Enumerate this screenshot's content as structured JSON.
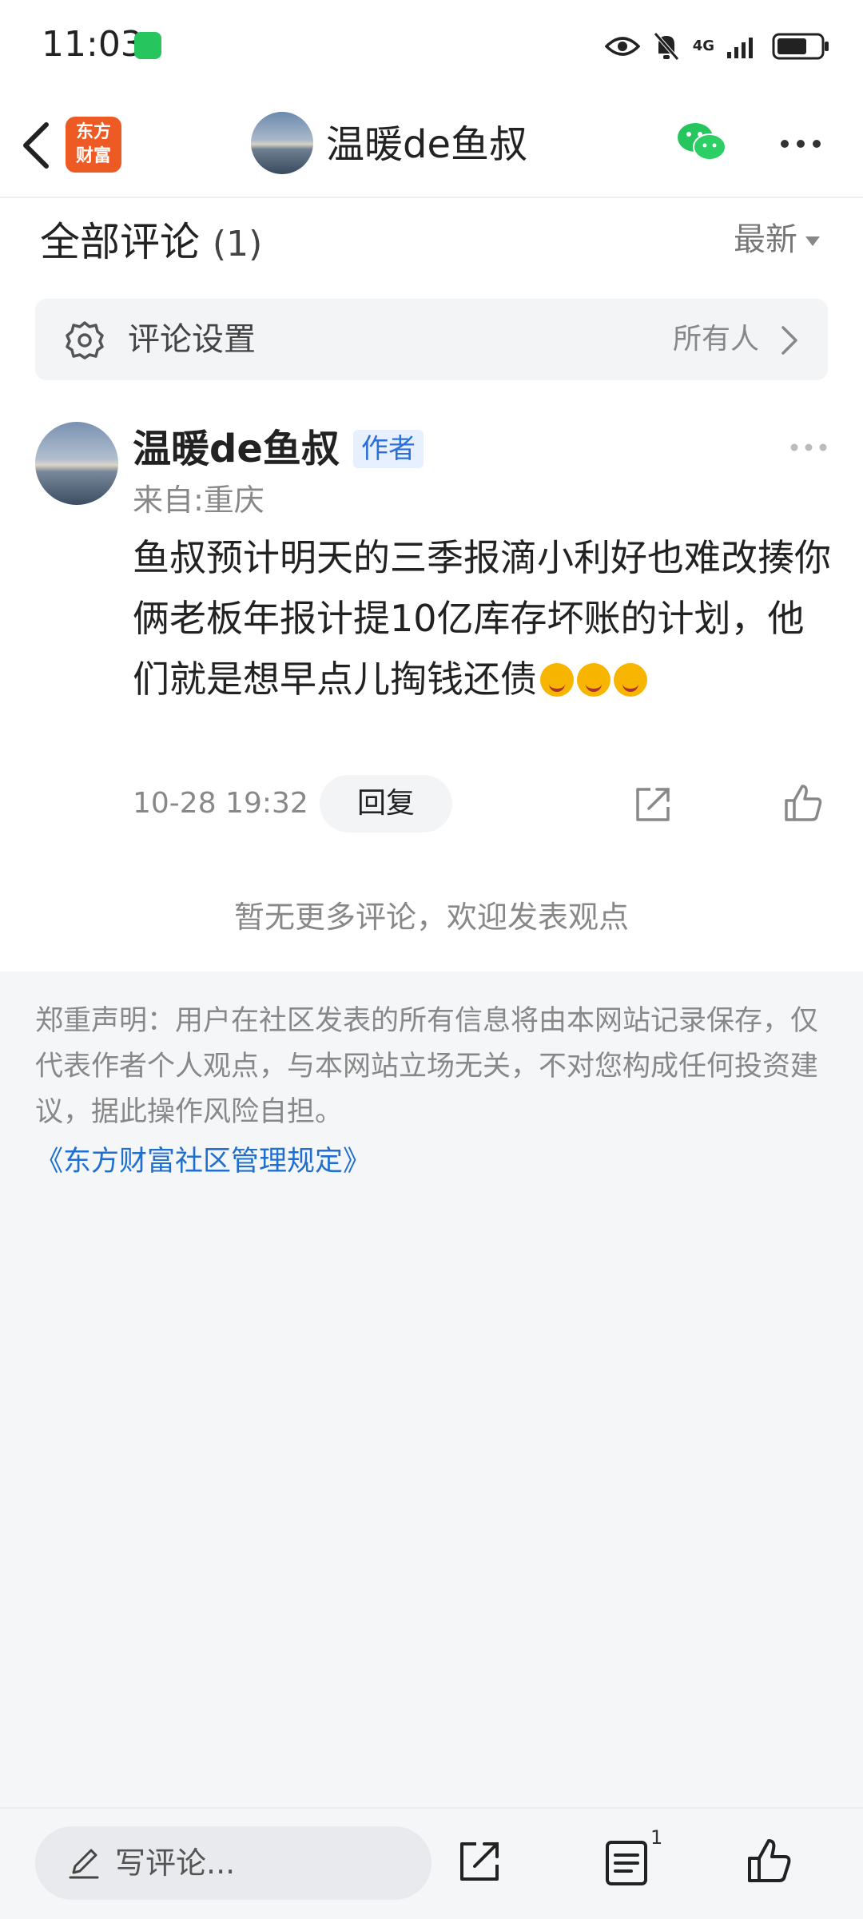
{
  "status_bar": {
    "time": "11:03",
    "network": "4G"
  },
  "nav": {
    "logo_line1": "东方",
    "logo_line2": "财富",
    "title": "温暖de鱼叔"
  },
  "comments_header": {
    "title": "全部评论",
    "count": "(1)",
    "sort": "最新"
  },
  "comment_settings": {
    "label": "评论设置",
    "value": "所有人"
  },
  "comment": {
    "username": "温暖de鱼叔",
    "badge": "作者",
    "location": "来自:重庆",
    "text": "鱼叔预计明天的三季报滴小利好也难改揍你俩老板年报计提10亿库存坏账的计划，他们就是想早点儿掏钱还债",
    "timestamp": "10-28 19:32",
    "reply_label": "回复"
  },
  "no_more_text": "暂无更多评论，欢迎发表观点",
  "disclaimer": {
    "text": "郑重声明：用户在社区发表的所有信息将由本网站记录保存，仅代表作者个人观点，与本网站立场无关，不对您构成任何投资建议，据此操作风险自担。",
    "link": "《东方财富社区管理规定》"
  },
  "bottom_bar": {
    "input_placeholder": "写评论...",
    "list_count": "1"
  },
  "colors": {
    "brand_orange": "#ee5a24",
    "link_blue": "#1f6fd0",
    "badge_blue": "#2c6fd8"
  },
  "icons": [
    "back-icon",
    "eye-icon",
    "bell-muted-icon",
    "signal-icon",
    "battery-icon",
    "wechat-icon",
    "more-icon",
    "gear-icon",
    "chevron-right-icon",
    "share-icon",
    "like-icon",
    "pencil-icon",
    "list-icon"
  ]
}
